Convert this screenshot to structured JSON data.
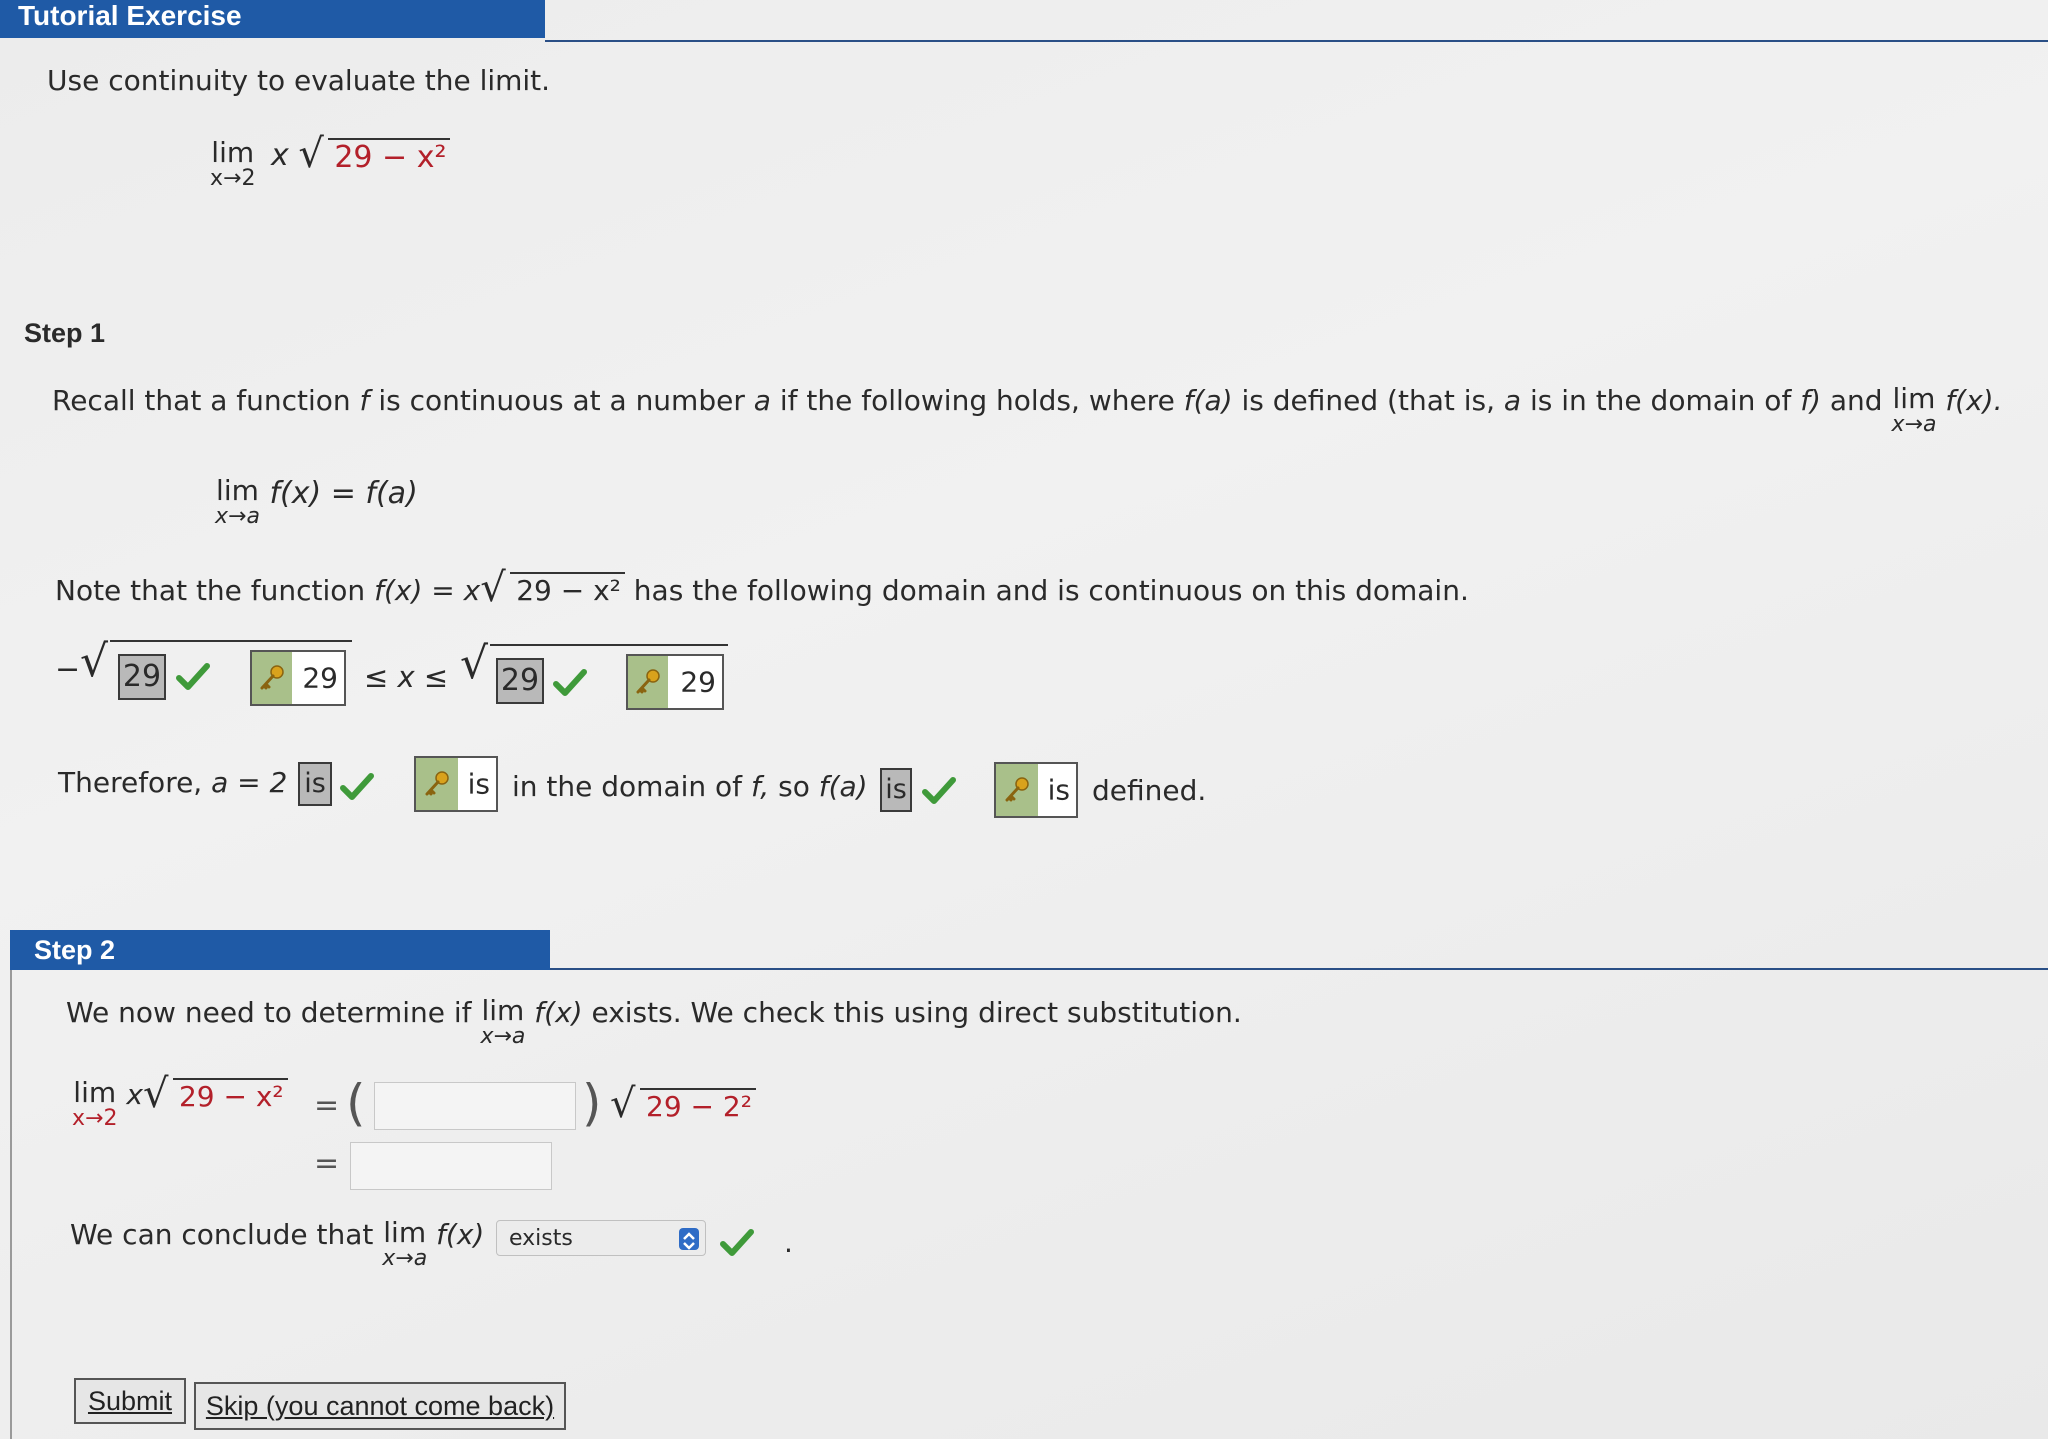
{
  "header": {
    "title": "Tutorial Exercise"
  },
  "problem": {
    "instruction": "Use continuity to evaluate the limit.",
    "lim": "lim",
    "lim_sub": "x→2",
    "expr_x": "x",
    "radicand": "29 − x²"
  },
  "step1": {
    "title": "Step 1",
    "recall_text_1": "Recall that a function",
    "recall_f": "f",
    "recall_text_2": "is continuous at a number",
    "recall_a": "a",
    "recall_text_3": "if the following holds, where",
    "recall_fa": "f(a)",
    "recall_text_4": "is defined (that is,",
    "recall_text_5": "is in the domain of",
    "recall_text_6": "f)",
    "recall_and": "and",
    "recall_lim": "lim",
    "recall_lim_sub": "x→a",
    "recall_fx": "f(x).",
    "def_lim": "lim",
    "def_sub": "x→a",
    "def_eq": "f(x) = f(a)",
    "note_text_1": "Note that the function",
    "note_fx": "f(x) = x",
    "note_radicand": "29 − x²",
    "note_text_2": "has the following domain and is continuous on this domain.",
    "domain": {
      "neg_sign": "−",
      "answer1": "29",
      "key1": "29",
      "ineq": "≤ x ≤",
      "answer2": "29",
      "key2": "29"
    },
    "therefore_1": "Therefore,",
    "therefore_a": "a = 2",
    "answer_is_1": "is",
    "key_is_1": "is",
    "therefore_2": "in the domain of",
    "therefore_f": "f,",
    "therefore_3": "so",
    "therefore_fa": "f(a)",
    "answer_is_2": "is",
    "key_is_2": "is",
    "therefore_4": "defined."
  },
  "step2": {
    "title": "Step 2",
    "text_1": "We now need to determine if",
    "lim": "lim",
    "lim_sub": "x→a",
    "text_fx": "f(x)",
    "text_2": "exists. We check this using direct substitution.",
    "eq_lim": "lim",
    "eq_sub": "x→2",
    "eq_x": "x",
    "eq_radicand": "29 − x²",
    "eq_sign": "=",
    "sub_radicand": "29 − 2²",
    "input1_value": "",
    "input2_value": "",
    "conclude_text": "We can conclude that",
    "conclude_lim": "lim",
    "conclude_sub": "x→a",
    "conclude_fx": "f(x)",
    "select_value": "exists",
    "period": "."
  },
  "buttons": {
    "submit": "Submit",
    "skip": "Skip (you cannot come back)"
  },
  "colors": {
    "header_blue": "#1f5aa6",
    "check_green": "#3f9a3a",
    "key_green": "#a9c08a",
    "red": "#b3202a"
  }
}
